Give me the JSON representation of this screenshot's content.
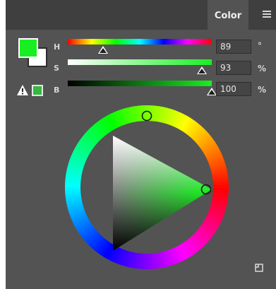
{
  "panel": {
    "tab_label": "Color",
    "menu_icon": "menu-icon"
  },
  "swatches": {
    "foreground_color": "#19ee23",
    "background_color": "#ffffff",
    "websafe_color": "#35b83f",
    "warning_icon": "warning-triangle-icon"
  },
  "channels": [
    {
      "label": "H",
      "value": "89",
      "unit": "°",
      "fraction": 0.247
    },
    {
      "label": "S",
      "value": "93",
      "unit": "%",
      "fraction": 0.93
    },
    {
      "label": "B",
      "value": "100",
      "unit": "%",
      "fraction": 1.0
    }
  ],
  "footer": {
    "resize_icon": "resize-corner-icon"
  }
}
